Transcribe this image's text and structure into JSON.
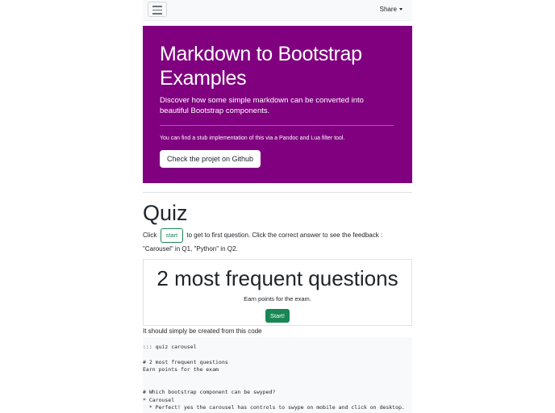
{
  "navbar": {
    "share_label": "Share"
  },
  "hero": {
    "title_line1": "Markdown to Bootstrap",
    "title_line2": "Examples",
    "lead": "Discover how some simple markdown can be converted into beautiful Bootstrap components.",
    "small_text": "You can find a stub implementation of this via a Pandoc and Lua filter tool.",
    "github_button": "Check the projet on Github"
  },
  "quiz": {
    "title": "Quiz",
    "intro_before": "Click",
    "start_inline_label": "start",
    "intro_after": "to get to first question. Click the correct answer to see the feedback : \"Carousel\" in Q1, \"Python\" in Q2.",
    "card_title": "2 most frequent questions",
    "card_subtitle": "Earn points for the exam.",
    "card_start_label": "Start!",
    "after_text": "It should simply be created from this code"
  },
  "code_lines": [
    "::: quiz carousel",
    "",
    "# 2 most frequent questions",
    "Earn points for the exam",
    "",
    "",
    "# Which bootstrap component can be swyped?",
    "* Carousel",
    "  * Perfect! yes the carousel has controls to swype on mobile and click on desktop."
  ]
}
